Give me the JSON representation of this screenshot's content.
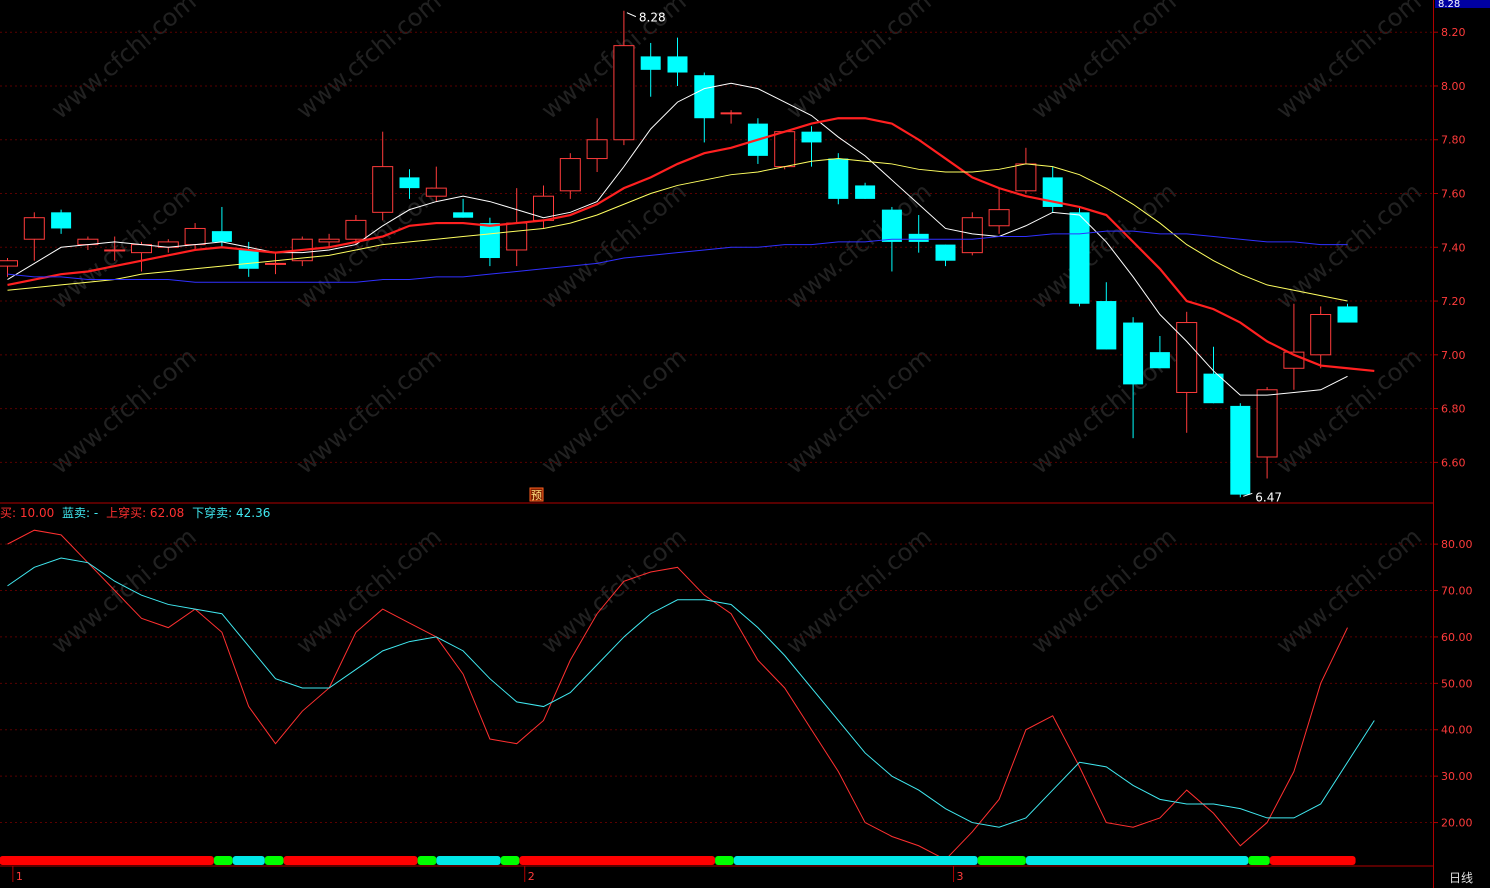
{
  "chart_data": [
    {
      "type": "candlestick",
      "panel": "price",
      "y_ticks": [
        "8.20",
        "8.00",
        "7.80",
        "7.60",
        "7.40",
        "7.20",
        "7.00",
        "6.80",
        "6.60"
      ],
      "ylim": [
        6.46,
        8.29
      ],
      "header_price_label": "8.28",
      "high_annotation": "8.28",
      "low_annotation": "6.47",
      "event_marker": "预",
      "candles": [
        {
          "o": 7.33,
          "h": 7.36,
          "l": 7.29,
          "c": 7.35
        },
        {
          "o": 7.43,
          "h": 7.53,
          "l": 7.35,
          "c": 7.51
        },
        {
          "o": 7.53,
          "h": 7.54,
          "l": 7.45,
          "c": 7.47
        },
        {
          "o": 7.41,
          "h": 7.44,
          "l": 7.39,
          "c": 7.43
        },
        {
          "o": 7.39,
          "h": 7.44,
          "l": 7.35,
          "c": 7.39
        },
        {
          "o": 7.38,
          "h": 7.42,
          "l": 7.31,
          "c": 7.41
        },
        {
          "o": 7.4,
          "h": 7.43,
          "l": 7.38,
          "c": 7.42
        },
        {
          "o": 7.41,
          "h": 7.49,
          "l": 7.39,
          "c": 7.47
        },
        {
          "o": 7.46,
          "h": 7.55,
          "l": 7.4,
          "c": 7.42
        },
        {
          "o": 7.39,
          "h": 7.42,
          "l": 7.29,
          "c": 7.32
        },
        {
          "o": 7.34,
          "h": 7.38,
          "l": 7.3,
          "c": 7.34
        },
        {
          "o": 7.35,
          "h": 7.44,
          "l": 7.33,
          "c": 7.43
        },
        {
          "o": 7.42,
          "h": 7.45,
          "l": 7.4,
          "c": 7.43
        },
        {
          "o": 7.43,
          "h": 7.52,
          "l": 7.41,
          "c": 7.5
        },
        {
          "o": 7.53,
          "h": 7.83,
          "l": 7.5,
          "c": 7.7
        },
        {
          "o": 7.66,
          "h": 7.69,
          "l": 7.58,
          "c": 7.62
        },
        {
          "o": 7.59,
          "h": 7.7,
          "l": 7.57,
          "c": 7.62
        },
        {
          "o": 7.53,
          "h": 7.58,
          "l": 7.51,
          "c": 7.51
        },
        {
          "o": 7.49,
          "h": 7.51,
          "l": 7.33,
          "c": 7.36
        },
        {
          "o": 7.39,
          "h": 7.62,
          "l": 7.33,
          "c": 7.49
        },
        {
          "o": 7.5,
          "h": 7.63,
          "l": 7.47,
          "c": 7.59
        },
        {
          "o": 7.61,
          "h": 7.75,
          "l": 7.58,
          "c": 7.73
        },
        {
          "o": 7.73,
          "h": 7.88,
          "l": 7.68,
          "c": 7.8
        },
        {
          "o": 7.8,
          "h": 8.28,
          "l": 7.78,
          "c": 8.15
        },
        {
          "o": 8.11,
          "h": 8.16,
          "l": 7.96,
          "c": 8.06
        },
        {
          "o": 8.11,
          "h": 8.18,
          "l": 8.0,
          "c": 8.05
        },
        {
          "o": 8.04,
          "h": 8.05,
          "l": 7.79,
          "c": 7.88
        },
        {
          "o": 7.9,
          "h": 7.91,
          "l": 7.86,
          "c": 7.9
        },
        {
          "o": 7.86,
          "h": 7.88,
          "l": 7.71,
          "c": 7.74
        },
        {
          "o": 7.7,
          "h": 7.83,
          "l": 7.69,
          "c": 7.83
        },
        {
          "o": 7.83,
          "h": 7.85,
          "l": 7.7,
          "c": 7.79
        },
        {
          "o": 7.73,
          "h": 7.75,
          "l": 7.56,
          "c": 7.58
        },
        {
          "o": 7.63,
          "h": 7.64,
          "l": 7.58,
          "c": 7.58
        },
        {
          "o": 7.54,
          "h": 7.55,
          "l": 7.31,
          "c": 7.42
        },
        {
          "o": 7.45,
          "h": 7.52,
          "l": 7.38,
          "c": 7.42
        },
        {
          "o": 7.41,
          "h": 7.41,
          "l": 7.33,
          "c": 7.35
        },
        {
          "o": 7.38,
          "h": 7.53,
          "l": 7.37,
          "c": 7.51
        },
        {
          "o": 7.48,
          "h": 7.62,
          "l": 7.45,
          "c": 7.54
        },
        {
          "o": 7.61,
          "h": 7.77,
          "l": 7.6,
          "c": 7.71
        },
        {
          "o": 7.66,
          "h": 7.7,
          "l": 7.53,
          "c": 7.55
        },
        {
          "o": 7.53,
          "h": 7.55,
          "l": 7.18,
          "c": 7.19
        },
        {
          "o": 7.2,
          "h": 7.27,
          "l": 7.02,
          "c": 7.02
        },
        {
          "o": 7.12,
          "h": 7.14,
          "l": 6.69,
          "c": 6.89
        },
        {
          "o": 7.01,
          "h": 7.07,
          "l": 6.95,
          "c": 6.95
        },
        {
          "o": 6.86,
          "h": 7.16,
          "l": 6.71,
          "c": 7.12
        },
        {
          "o": 6.93,
          "h": 7.03,
          "l": 6.82,
          "c": 6.82
        },
        {
          "o": 6.81,
          "h": 6.82,
          "l": 6.47,
          "c": 6.48
        },
        {
          "o": 6.62,
          "h": 6.88,
          "l": 6.54,
          "c": 6.87
        },
        {
          "o": 6.95,
          "h": 7.19,
          "l": 6.87,
          "c": 7.01
        },
        {
          "o": 7.0,
          "h": 7.18,
          "l": 6.95,
          "c": 7.15
        },
        {
          "o": 7.18,
          "h": 7.19,
          "l": 7.12,
          "c": 7.12
        }
      ],
      "series": [
        {
          "color": "#ffffff",
          "values": [
            7.28,
            7.34,
            7.4,
            7.41,
            7.42,
            7.41,
            7.4,
            7.41,
            7.42,
            7.4,
            7.38,
            7.38,
            7.39,
            7.41,
            7.48,
            7.54,
            7.57,
            7.59,
            7.57,
            7.54,
            7.51,
            7.53,
            7.57,
            7.7,
            7.84,
            7.94,
            7.99,
            8.01,
            7.99,
            7.94,
            7.89,
            7.81,
            7.74,
            7.65,
            7.56,
            7.47,
            7.45,
            7.44,
            7.48,
            7.53,
            7.52,
            7.42,
            7.29,
            7.15,
            7.05,
            6.94,
            6.85,
            6.85,
            6.86,
            6.87,
            6.92
          ]
        },
        {
          "color": "#ff2020",
          "values": [
            7.26,
            7.28,
            7.3,
            7.31,
            7.33,
            7.35,
            7.37,
            7.39,
            7.4,
            7.39,
            7.38,
            7.39,
            7.4,
            7.42,
            7.44,
            7.48,
            7.49,
            7.49,
            7.48,
            7.49,
            7.5,
            7.52,
            7.56,
            7.62,
            7.66,
            7.71,
            7.75,
            7.77,
            7.8,
            7.83,
            7.86,
            7.88,
            7.88,
            7.86,
            7.8,
            7.73,
            7.66,
            7.62,
            7.59,
            7.57,
            7.55,
            7.52,
            7.42,
            7.32,
            7.2,
            7.17,
            7.12,
            7.05,
            7.0,
            6.96,
            6.95,
            6.94
          ]
        },
        {
          "color": "#ffff60",
          "values": [
            7.24,
            7.25,
            7.26,
            7.27,
            7.28,
            7.3,
            7.31,
            7.32,
            7.33,
            7.34,
            7.35,
            7.36,
            7.37,
            7.39,
            7.41,
            7.42,
            7.43,
            7.44,
            7.45,
            7.46,
            7.47,
            7.49,
            7.52,
            7.56,
            7.6,
            7.63,
            7.65,
            7.67,
            7.68,
            7.7,
            7.72,
            7.73,
            7.72,
            7.71,
            7.69,
            7.68,
            7.68,
            7.69,
            7.71,
            7.7,
            7.67,
            7.62,
            7.56,
            7.49,
            7.41,
            7.35,
            7.3,
            7.26,
            7.24,
            7.22,
            7.2
          ]
        },
        {
          "color": "#3030ff",
          "values": [
            7.3,
            7.29,
            7.29,
            7.28,
            7.28,
            7.28,
            7.28,
            7.27,
            7.27,
            7.27,
            7.27,
            7.27,
            7.27,
            7.27,
            7.28,
            7.28,
            7.29,
            7.29,
            7.3,
            7.31,
            7.32,
            7.33,
            7.34,
            7.36,
            7.37,
            7.38,
            7.39,
            7.4,
            7.4,
            7.41,
            7.41,
            7.42,
            7.42,
            7.43,
            7.43,
            7.43,
            7.43,
            7.44,
            7.44,
            7.45,
            7.45,
            7.46,
            7.46,
            7.45,
            7.45,
            7.44,
            7.43,
            7.42,
            7.42,
            7.41,
            7.41
          ]
        }
      ]
    },
    {
      "type": "line",
      "panel": "indicator",
      "y_ticks": [
        "80.00",
        "70.00",
        "60.00",
        "50.00",
        "40.00",
        "30.00",
        "20.00"
      ],
      "ylim": [
        11.5,
        88
      ],
      "legend": [
        {
          "text": "买: 10.00",
          "color": "#ff3030"
        },
        {
          "text": "蓝卖: -",
          "color": "#40e8f0"
        },
        {
          "text": "上穿买: 62.08",
          "color": "#ff3030"
        },
        {
          "text": "下穿卖: 42.36",
          "color": "#40e8f0"
        }
      ],
      "series": [
        {
          "color": "#ff3030",
          "values": [
            80,
            83,
            82,
            76,
            70,
            64,
            62,
            66,
            61,
            45,
            37,
            44,
            49,
            61,
            66,
            63,
            60,
            52,
            38,
            37,
            42,
            55,
            65,
            72,
            74,
            75,
            69,
            65,
            55,
            49,
            40,
            31,
            20,
            17,
            15,
            12,
            18,
            25,
            40,
            43,
            32,
            20,
            19,
            21,
            27,
            22,
            15,
            20,
            31,
            50,
            62
          ]
        },
        {
          "color": "#40e8f0",
          "values": [
            71,
            75,
            77,
            76,
            72,
            69,
            67,
            66,
            65,
            58,
            51,
            49,
            49,
            53,
            57,
            59,
            60,
            57,
            51,
            46,
            45,
            48,
            54,
            60,
            65,
            68,
            68,
            67,
            62,
            56,
            49,
            42,
            35,
            30,
            27,
            23,
            20,
            19,
            21,
            27,
            33,
            32,
            28,
            25,
            24,
            24,
            23,
            21,
            21,
            24,
            33,
            42
          ]
        }
      ],
      "signal_bar": [
        {
          "color": "#ff0000",
          "from": 0,
          "to": 8
        },
        {
          "color": "#00ff00",
          "from": 8,
          "to": 8.7
        },
        {
          "color": "#00e8e8",
          "from": 8.7,
          "to": 9.9
        },
        {
          "color": "#00ff00",
          "from": 9.9,
          "to": 10.6
        },
        {
          "color": "#ff0000",
          "from": 10.6,
          "to": 15.6
        },
        {
          "color": "#00ff00",
          "from": 15.6,
          "to": 16.3
        },
        {
          "color": "#00e8e8",
          "from": 16.3,
          "to": 18.7
        },
        {
          "color": "#00ff00",
          "from": 18.7,
          "to": 19.4
        },
        {
          "color": "#ff0000",
          "from": 19.4,
          "to": 26.7
        },
        {
          "color": "#00ff00",
          "from": 26.7,
          "to": 27.4
        },
        {
          "color": "#00e8e8",
          "from": 27.4,
          "to": 36.5
        },
        {
          "color": "#00ff00",
          "from": 36.5,
          "to": 38.3
        },
        {
          "color": "#00e8e8",
          "from": 38.3,
          "to": 46.6
        },
        {
          "color": "#00ff00",
          "from": 46.6,
          "to": 47.4
        },
        {
          "color": "#ff0000",
          "from": 47.4,
          "to": 50.6
        }
      ],
      "x_ticks": [
        {
          "label": "1",
          "i": 0.2
        },
        {
          "label": "2",
          "i": 19.3
        },
        {
          "label": "3",
          "i": 35.3
        }
      ]
    }
  ],
  "watermark": "www.cfchi.com",
  "period_label": "日线",
  "colors": {
    "up": "#ff3b3b",
    "down": "#00ffff",
    "grid": "#5a0000",
    "frame": "#b00000"
  }
}
